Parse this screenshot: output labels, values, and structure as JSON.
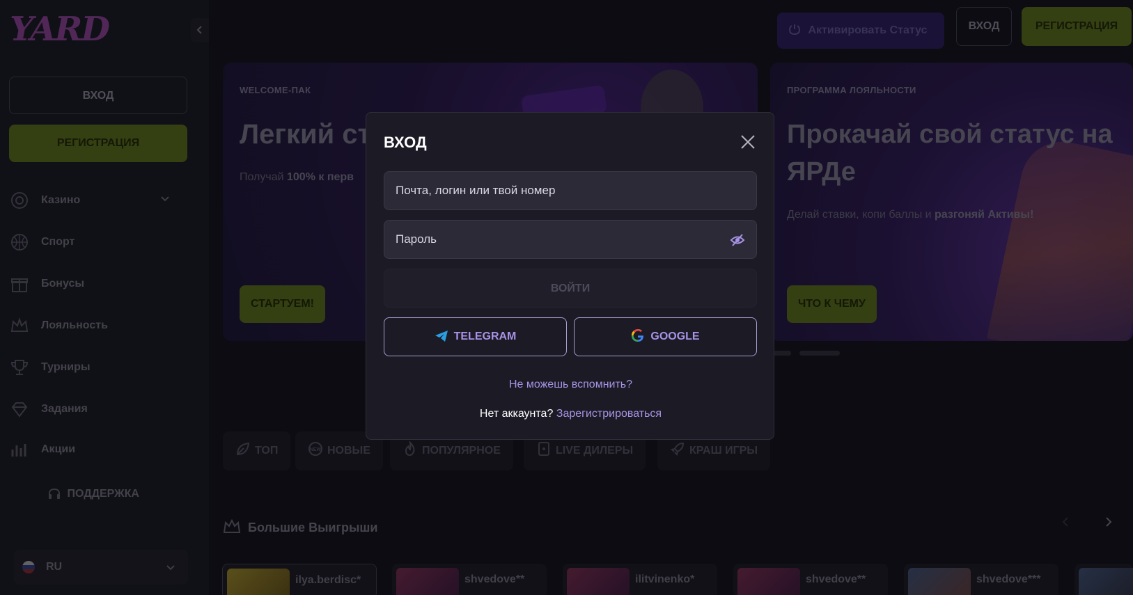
{
  "brand": {
    "logo_text": "YARD"
  },
  "header": {
    "activate_status_label": "Активировать Статус",
    "login_label": "ВХОД",
    "register_label": "РЕГИСТРАЦИЯ"
  },
  "sidebar": {
    "login_label": "ВХОД",
    "register_label": "РЕГИСТРАЦИЯ",
    "items": [
      {
        "label": "Казино",
        "icon": "casino-chip-icon",
        "has_dropdown": true
      },
      {
        "label": "Спорт",
        "icon": "basketball-icon"
      },
      {
        "label": "Бонусы",
        "icon": "gift-icon"
      },
      {
        "label": "Лояльность",
        "icon": "crown-icon"
      },
      {
        "label": "Турниры",
        "icon": "trophy-icon"
      },
      {
        "label": "Задания",
        "icon": "diamond-icon"
      },
      {
        "label": "Акции",
        "icon": "chart-icon"
      }
    ],
    "support_label": "ПОДДЕРЖКА",
    "language": "RU"
  },
  "banners": [
    {
      "tag": "WELCOME-ПАК",
      "title": "Легкий ст",
      "subtitle_prefix": "Получай ",
      "subtitle_bold": "100% к перв",
      "cta": "СТАРТУЕМ!"
    },
    {
      "tag": "ПРОГРАММА ЛОЯЛЬНОСТИ",
      "title": "Прокачай свой статус на ЯРДе",
      "subtitle_prefix": "Делай ставки, копи баллы и ",
      "subtitle_bold": "разгоняй Активы!",
      "cta": "ЧТО К ЧЕМУ"
    }
  ],
  "category_tabs": [
    {
      "label": "ТОП",
      "icon": "leaf-icon"
    },
    {
      "label": "НОВЫЕ",
      "icon": "new-badge-icon"
    },
    {
      "label": "ПОПУЛЯРНОЕ",
      "icon": "fire-icon"
    },
    {
      "label": "LIVE ДИЛЕРЫ",
      "icon": "card-icon"
    },
    {
      "label": "КРАШ ИГРЫ",
      "icon": "rocket-icon"
    }
  ],
  "big_wins": {
    "title": "Большие Выигрыши",
    "items": [
      {
        "user": "ilya.berdisc*"
      },
      {
        "user": "shvedove**"
      },
      {
        "user": "ilitvinenko*"
      },
      {
        "user": "shvedove**"
      },
      {
        "user": "shvedove***"
      }
    ]
  },
  "login_modal": {
    "title": "ВХОД",
    "login_placeholder": "Почта, логин или твой номер",
    "password_placeholder": "Пароль",
    "submit_label": "ВОЙТИ",
    "telegram_label": "TELEGRAM",
    "google_label": "GOOGLE",
    "forgot_label": "Не можешь вспомнить?",
    "no_account_label": "Нет аккаунта?",
    "register_link": "Зарегистрироваться"
  },
  "colors": {
    "accent_purple": "#a893e6",
    "accent_green": "#50621c",
    "background": "#14131d"
  }
}
